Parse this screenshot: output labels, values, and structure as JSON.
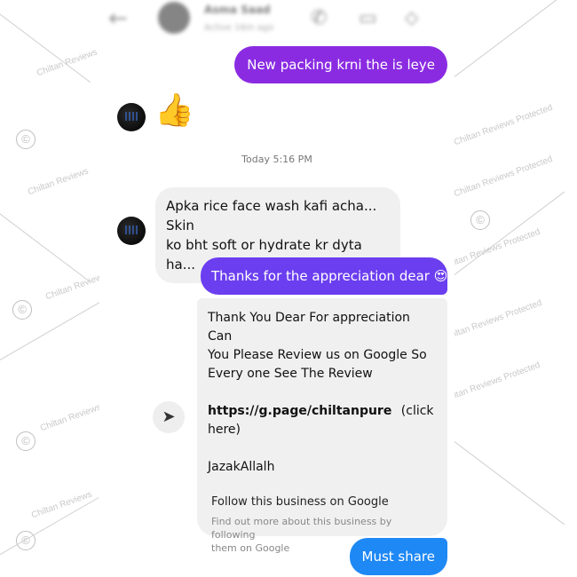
{
  "watermark": {
    "text": "Chiltan Reviews Protected",
    "left_text": "Chiltan Reviews",
    "copyright_symbol": "©"
  },
  "header": {
    "back_icon": "arrow-left-icon",
    "name": "Asma Saad",
    "status": "Active 16m ago",
    "icons": [
      "phone-icon",
      "video-icon",
      "tag-icon"
    ]
  },
  "messages": {
    "m1": "New packing krni the is leye",
    "reaction": "👍",
    "timestamp": "Today 5:16 PM",
    "m2_line1": "Apka rice face wash kafi acha... Skin",
    "m2_line2": "ko bht soft or hydrate kr dyta ha...",
    "m3": "Thanks for the appreciation dear 😍",
    "card": {
      "line1": "Thank You Dear For appreciation Can",
      "line2": "You Please Review us on Google So",
      "line3": "Every one See The Review",
      "link": "https://g.page/chiltanpure",
      "link_suffix": "(click",
      "link_suffix2": "here)",
      "sign": "JazakAllalh",
      "follow_title": "Follow this business on Google",
      "follow_sub1": "Find out more about this business by following",
      "follow_sub2": "them on Google"
    },
    "m4": "Must share"
  },
  "colors": {
    "purple": "#8a2be2",
    "violet": "#6b3ef0",
    "blue": "#1e88f5",
    "incoming_bg": "#f0f0f0"
  }
}
